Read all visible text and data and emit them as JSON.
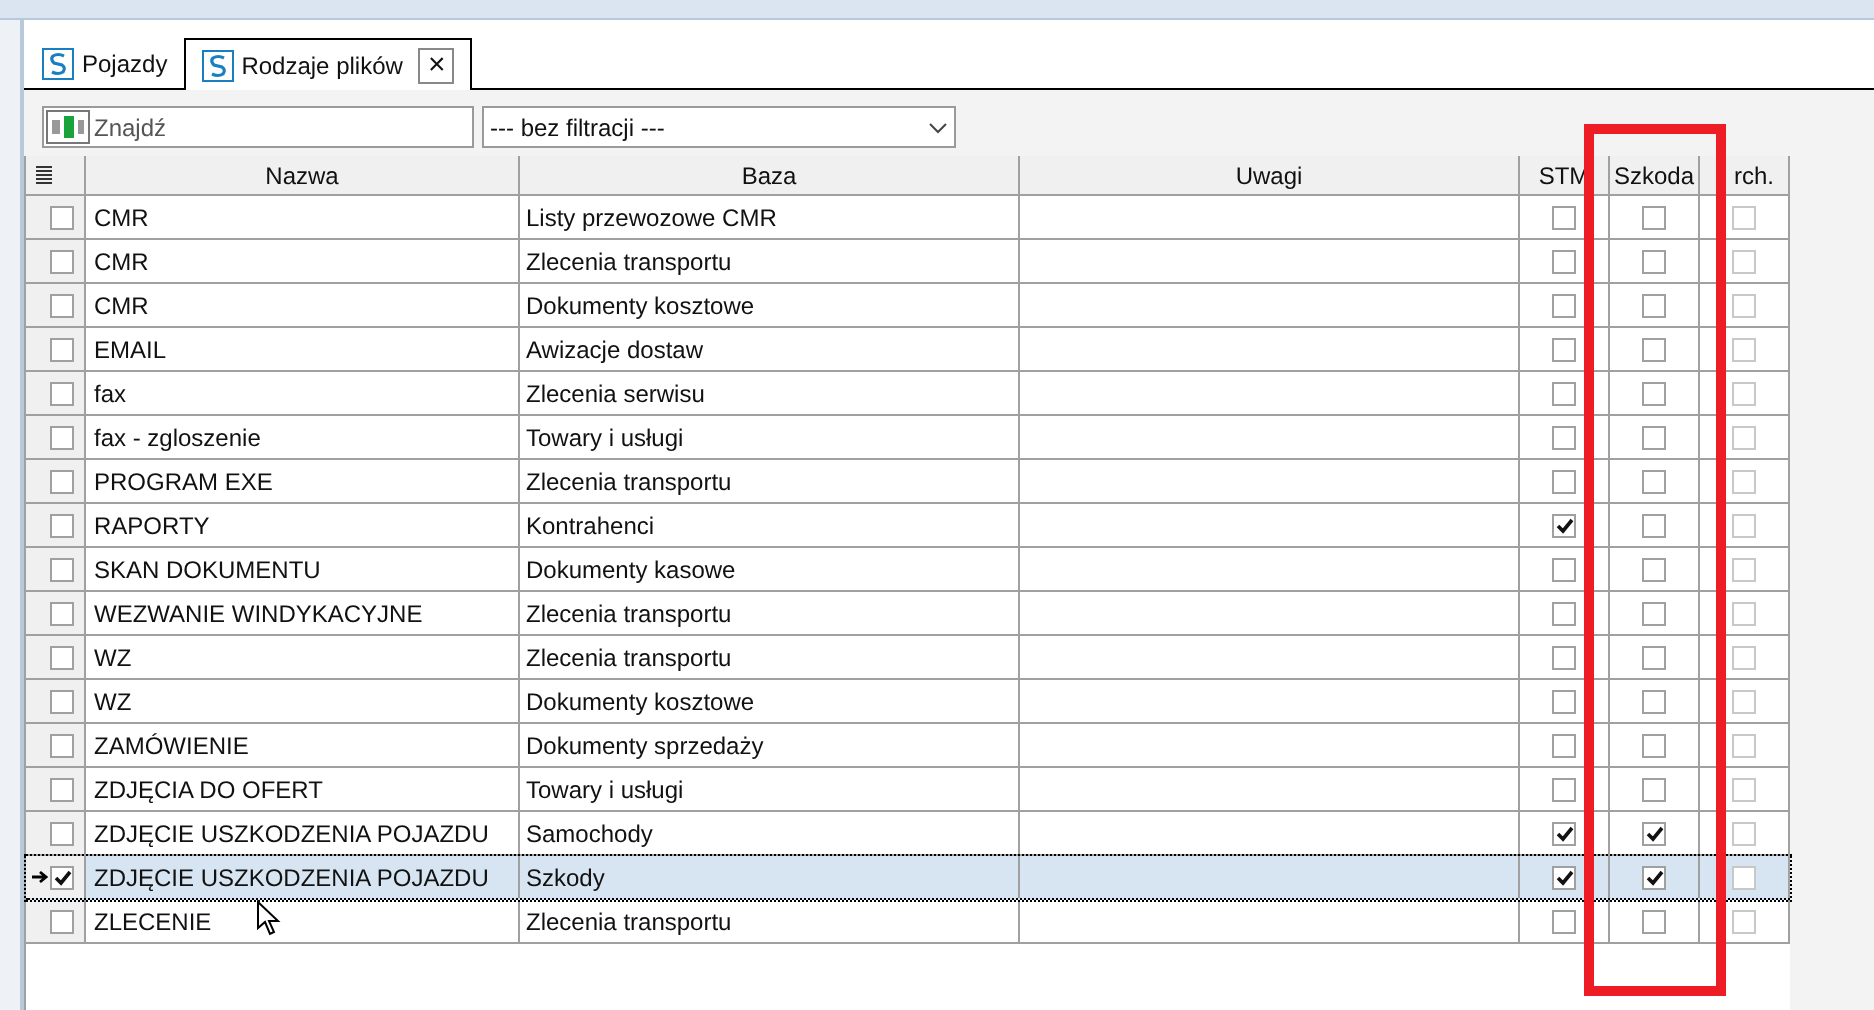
{
  "tabs": [
    {
      "label": "Pojazdy",
      "selected": false,
      "closable": false
    },
    {
      "label": "Rodzaje plików",
      "selected": true,
      "closable": true
    }
  ],
  "close_tab_label": "×",
  "search": {
    "placeholder": "Znajdź"
  },
  "filter": {
    "value": "--- bez filtracji ---"
  },
  "table": {
    "columns": [
      "Nazwa",
      "Baza",
      "Uwagi",
      "STM",
      "Szkoda",
      "rch."
    ],
    "rows": [
      {
        "name": "CMR",
        "base": "Listy przewozowe CMR",
        "checked": false,
        "stm": false,
        "szkoda": false,
        "arch": false,
        "selected": false
      },
      {
        "name": "CMR",
        "base": "Zlecenia transportu",
        "checked": false,
        "stm": false,
        "szkoda": false,
        "arch": false,
        "selected": false
      },
      {
        "name": "CMR",
        "base": "Dokumenty kosztowe",
        "checked": false,
        "stm": false,
        "szkoda": false,
        "arch": false,
        "selected": false
      },
      {
        "name": "EMAIL",
        "base": "Awizacje dostaw",
        "checked": false,
        "stm": false,
        "szkoda": false,
        "arch": false,
        "selected": false
      },
      {
        "name": "fax",
        "base": "Zlecenia serwisu",
        "checked": false,
        "stm": false,
        "szkoda": false,
        "arch": false,
        "selected": false
      },
      {
        "name": "fax - zgloszenie",
        "base": "Towary i usługi",
        "checked": false,
        "stm": false,
        "szkoda": false,
        "arch": false,
        "selected": false
      },
      {
        "name": "PROGRAM EXE",
        "base": "Zlecenia transportu",
        "checked": false,
        "stm": false,
        "szkoda": false,
        "arch": false,
        "selected": false
      },
      {
        "name": "RAPORTY",
        "base": "Kontrahenci",
        "checked": false,
        "stm": true,
        "szkoda": false,
        "arch": false,
        "selected": false
      },
      {
        "name": "SKAN DOKUMENTU",
        "base": "Dokumenty kasowe",
        "checked": false,
        "stm": false,
        "szkoda": false,
        "arch": false,
        "selected": false
      },
      {
        "name": "WEZWANIE WINDYKACYJNE",
        "base": "Zlecenia transportu",
        "checked": false,
        "stm": false,
        "szkoda": false,
        "arch": false,
        "selected": false
      },
      {
        "name": "WZ",
        "base": "Zlecenia transportu",
        "checked": false,
        "stm": false,
        "szkoda": false,
        "arch": false,
        "selected": false
      },
      {
        "name": "WZ",
        "base": "Dokumenty kosztowe",
        "checked": false,
        "stm": false,
        "szkoda": false,
        "arch": false,
        "selected": false
      },
      {
        "name": "ZAMÓWIENIE",
        "base": "Dokumenty sprzedaży",
        "checked": false,
        "stm": false,
        "szkoda": false,
        "arch": false,
        "selected": false
      },
      {
        "name": "ZDJĘCIA DO OFERT",
        "base": "Towary i usługi",
        "checked": false,
        "stm": false,
        "szkoda": false,
        "arch": false,
        "selected": false
      },
      {
        "name": "ZDJĘCIE USZKODZENIA POJAZDU",
        "base": "Samochody",
        "checked": false,
        "stm": true,
        "szkoda": true,
        "arch": false,
        "selected": false
      },
      {
        "name": "ZDJĘCIE USZKODZENIA POJAZDU",
        "base": "Szkody",
        "checked": true,
        "stm": true,
        "szkoda": true,
        "arch": false,
        "selected": true
      },
      {
        "name": "ZLECENIE",
        "base": "Zlecenia transportu",
        "checked": false,
        "stm": false,
        "szkoda": false,
        "arch": false,
        "selected": false
      }
    ]
  }
}
